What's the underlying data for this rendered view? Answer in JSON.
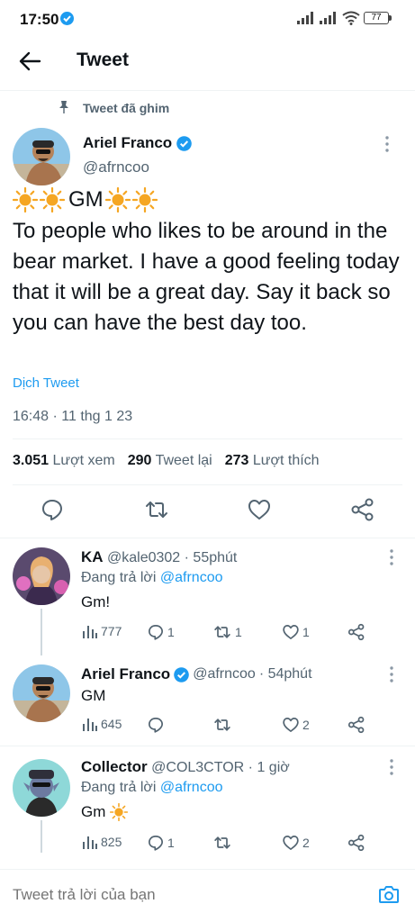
{
  "status_bar": {
    "time": "17:50",
    "battery": "77"
  },
  "header": {
    "title": "Tweet"
  },
  "pinned": {
    "label": "Tweet đã ghim"
  },
  "main_tweet": {
    "author_name": "Ariel Franco",
    "handle": "@afrncoo",
    "gm": "GM",
    "body": "To people who likes to be around in the bear market. I have a good feeling today that it will be a great day. Say it back so you can have the best day too.",
    "translate": "Dịch Tweet",
    "timestamp": "16:48 · 11 thg 1 23",
    "stats": {
      "views_num": "3.051",
      "views_label": "Lượt xem",
      "retweets_num": "290",
      "retweets_label": "Tweet lại",
      "likes_num": "273",
      "likes_label": "Lượt thích"
    }
  },
  "replies": [
    {
      "name": "KA",
      "handle": "@kale0302",
      "time": "· 55phút",
      "replying_prefix": "Đang trả lời",
      "replying_to": "@afrncoo",
      "text": "Gm!",
      "views": "777",
      "replies": "1",
      "retweets": "1",
      "likes": "1"
    },
    {
      "name": "Ariel Franco",
      "handle": "@afrncoo",
      "time": "· 54phút",
      "text": "GM",
      "views": "645",
      "replies": "",
      "retweets": "",
      "likes": "2"
    },
    {
      "name": "Collector",
      "handle": "@COL3CTOR",
      "time": "· 1 giờ",
      "replying_prefix": "Đang trả lời",
      "replying_to": "@afrncoo",
      "text": "Gm",
      "views": "825",
      "replies": "1",
      "retweets": "",
      "likes": "2"
    }
  ],
  "composer": {
    "placeholder": "Tweet trả lời của bạn"
  },
  "colors": {
    "accent": "#1d9bf0",
    "muted": "#536471",
    "divider": "#eff3f4",
    "sun": "#f5a623"
  }
}
